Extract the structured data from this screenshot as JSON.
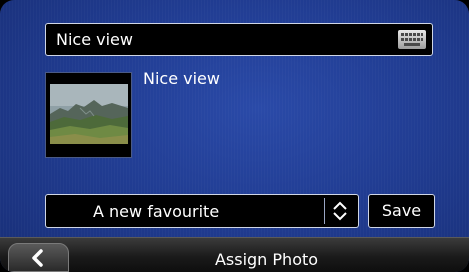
{
  "name_field": {
    "value": "Nice view",
    "keyboard_icon": "keyboard-icon"
  },
  "photo": {
    "caption": "Nice view",
    "thumbnail": "landscape-photo"
  },
  "favourite_select": {
    "value": "A new favourite",
    "spin_icon": "up-down-chevron-icon"
  },
  "save_button": {
    "label": "Save"
  },
  "footer": {
    "title": "Assign Photo",
    "back_icon": "back-chevron-icon"
  },
  "colors": {
    "background": "#213d93",
    "field": "#000000",
    "text": "#ffffff"
  }
}
